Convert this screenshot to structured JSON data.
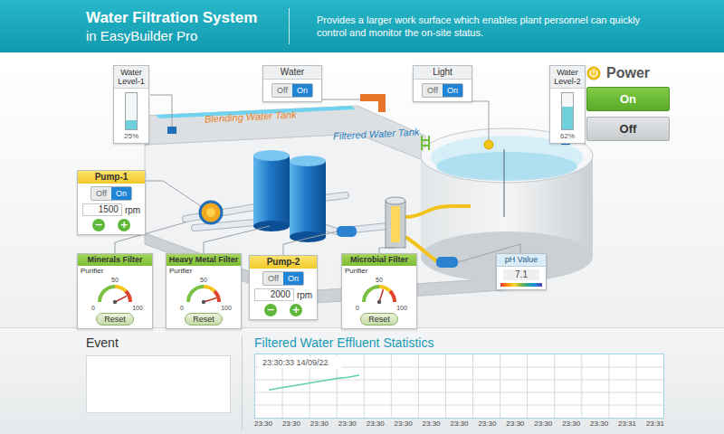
{
  "header": {
    "title": "Water Filtration System",
    "subtitle": "in EasyBuilder Pro",
    "description": "Provides a larger work surface which enables plant personnel can quickly control and monitor the on-site status."
  },
  "tank_labels": {
    "blending": "Blending Water Tank",
    "filtered": "Filtered Water Tank"
  },
  "level_gauges": [
    {
      "label": "Water Level-1",
      "reading": "25%",
      "level": 0.25
    },
    {
      "label": "Water Level-2",
      "reading": "62%",
      "level": 0.62
    }
  ],
  "switches": [
    {
      "label": "Water",
      "options": [
        {
          "label": "Off",
          "selected": false
        },
        {
          "label": "On",
          "selected": true
        }
      ]
    },
    {
      "label": "Light",
      "options": [
        {
          "label": "Off",
          "selected": false
        },
        {
          "label": "On",
          "selected": true
        }
      ]
    }
  ],
  "power": {
    "label": "Power",
    "buttons": [
      {
        "label": "On",
        "selected": true
      },
      {
        "label": "Off",
        "selected": false
      }
    ]
  },
  "pumps": [
    {
      "label": "Pump-1",
      "options": [
        {
          "label": "Off",
          "selected": false
        },
        {
          "label": "On",
          "selected": true
        }
      ],
      "speed": "1500",
      "unit": "rpm",
      "buttons": [
        "−",
        "+"
      ]
    },
    {
      "label": "Pump-2",
      "options": [
        {
          "label": "Off",
          "selected": false
        },
        {
          "label": "On",
          "selected": true
        }
      ],
      "speed": "2000",
      "unit": "rpm",
      "buttons": [
        "−",
        "+"
      ]
    }
  ],
  "filters": [
    {
      "label": "Minerals Filter",
      "gauge_label": "Purifier",
      "ticks": [
        "0",
        "50",
        "100"
      ],
      "level": 0.85,
      "button": "Reset"
    },
    {
      "label": "Heavy Metal Filter",
      "gauge_label": "Purifier",
      "ticks": [
        "0",
        "50",
        "100"
      ],
      "level": 0.9,
      "button": "Reset"
    },
    {
      "label": "Microbial Filter",
      "gauge_label": "Purifier",
      "ticks": [
        "0",
        "50",
        "100"
      ],
      "level": 0.6,
      "button": "Reset"
    }
  ],
  "ph": {
    "label": "pH Value",
    "reading": "7.1"
  },
  "event": {
    "title": "Event"
  },
  "chart": {
    "title": "Filtered Water Effluent Statistics",
    "timestamp": "23:30:33 14/09/22",
    "x_ticks": [
      "23:30",
      "23:30",
      "23:30",
      "23:30",
      "23:30",
      "23:30",
      "23:30",
      "23:30",
      "23:30",
      "23:30",
      "23:30",
      "23:30",
      "23:30",
      "23:31",
      "23:31"
    ],
    "y_min": 0,
    "y_max": 100,
    "series": [
      {
        "values": [
          44,
          47,
          50,
          53,
          56,
          59,
          62,
          64,
          67
        ]
      }
    ]
  }
}
